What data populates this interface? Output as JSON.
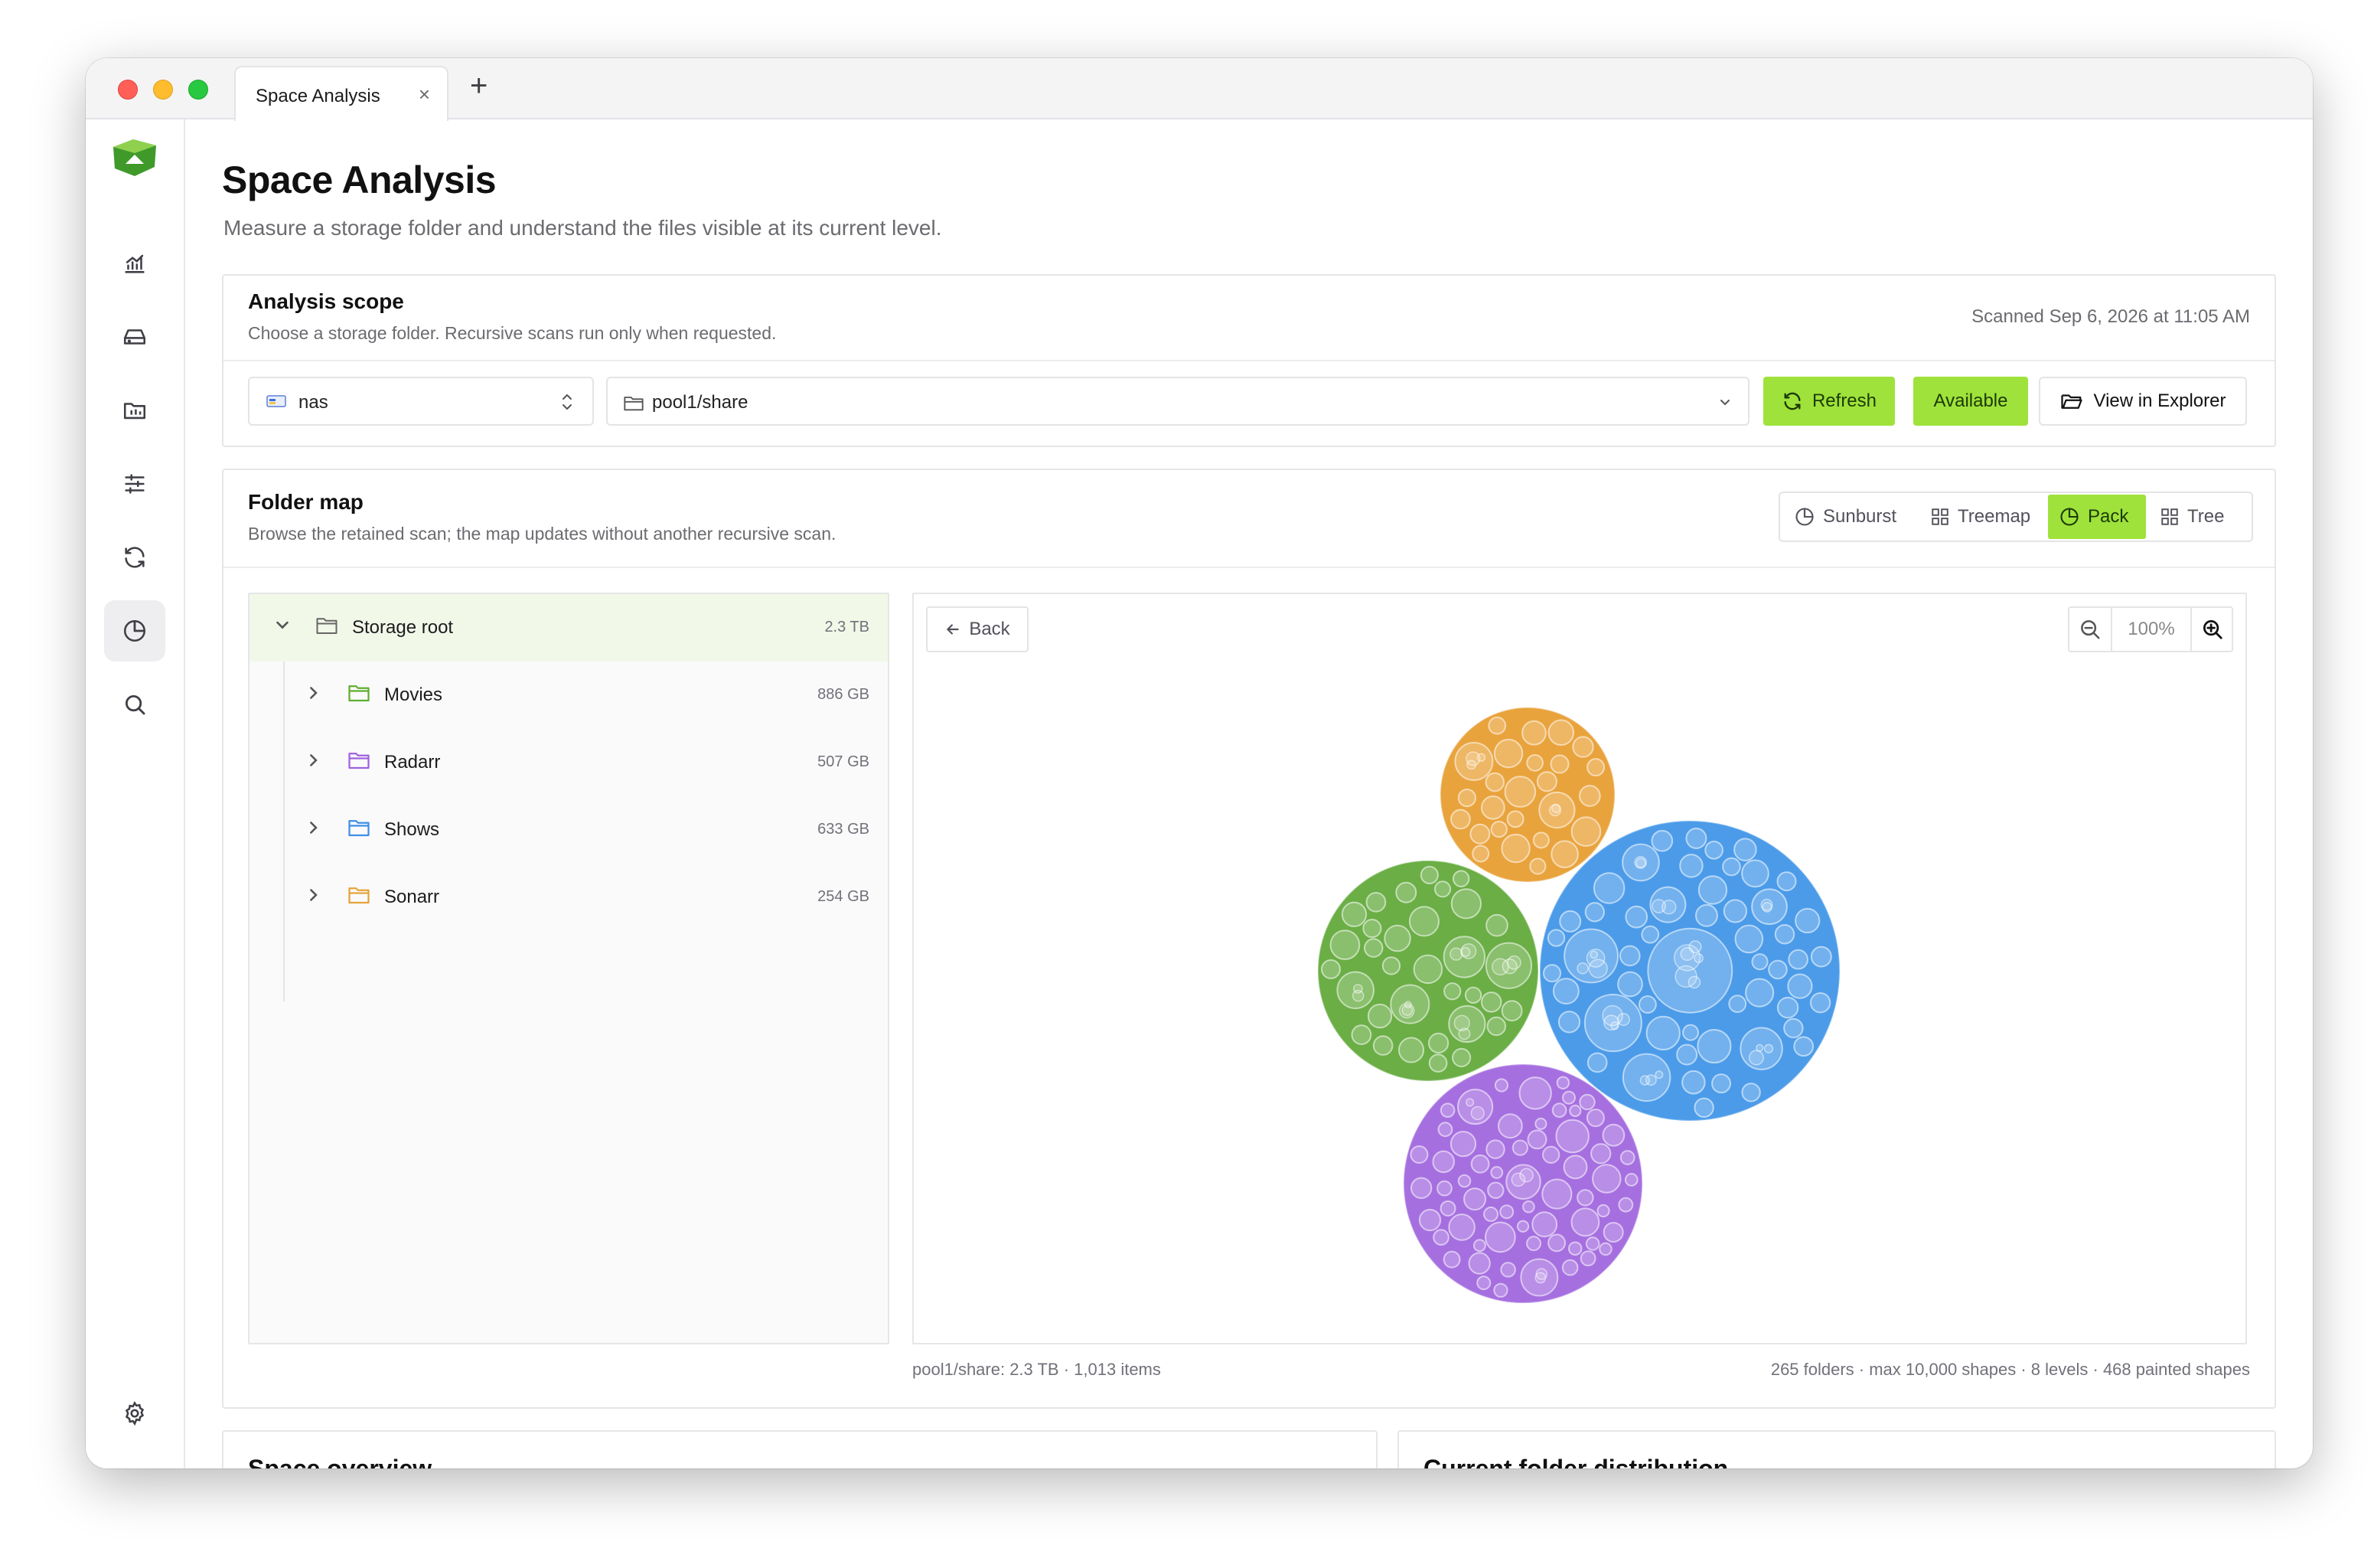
{
  "window": {
    "tab_title": "Space Analysis",
    "tab_close": "×",
    "new_tab": "+"
  },
  "sidebar": {
    "items": [
      {
        "name": "dashboard",
        "icon": "chart-bars-icon"
      },
      {
        "name": "storage",
        "icon": "drive-icon"
      },
      {
        "name": "files",
        "icon": "folder-grid-icon"
      },
      {
        "name": "settings-sliders",
        "icon": "sliders-icon"
      },
      {
        "name": "sync",
        "icon": "refresh-icon"
      },
      {
        "name": "space-analysis",
        "icon": "pie-chart-icon",
        "active": true
      },
      {
        "name": "search",
        "icon": "search-icon"
      }
    ],
    "bottom": {
      "name": "settings",
      "icon": "gear-icon"
    }
  },
  "page": {
    "title": "Space Analysis",
    "subtitle": "Measure a storage folder and understand the files visible at its current level."
  },
  "scope": {
    "title": "Analysis scope",
    "description": "Choose a storage folder. Recursive scans run only when requested.",
    "scanned": "Scanned Sep 6, 2026 at 11:05 AM",
    "storage_value": "nas",
    "path_value": "pool1/share",
    "refresh_label": "Refresh",
    "available_label": "Available",
    "explorer_label": "View in Explorer"
  },
  "folder_map": {
    "title": "Folder map",
    "description": "Browse the retained scan; the map updates without another recursive scan.",
    "views": [
      "Sunburst",
      "Treemap",
      "Pack",
      "Tree"
    ],
    "active_view": "Pack",
    "tree": {
      "root": {
        "label": "Storage root",
        "size": "2.3 TB"
      },
      "children": [
        {
          "label": "Movies",
          "size": "886 GB",
          "color": "#5fae2e"
        },
        {
          "label": "Radarr",
          "size": "507 GB",
          "color": "#a061e0"
        },
        {
          "label": "Shows",
          "size": "633 GB",
          "color": "#3d8fe6"
        },
        {
          "label": "Sonarr",
          "size": "254 GB",
          "color": "#e5a33a"
        }
      ]
    },
    "back_label": "Back",
    "zoom": "100%",
    "footer_left": "pool1/share: 2.3 TB · 1,013 items",
    "footer_right": "265 folders · max 10,000 shapes · 8 levels · 468 painted shapes",
    "pack_colors": {
      "orange": "#e9a33c",
      "green": "#6aae45",
      "blue": "#4b9be9",
      "purple": "#a66fe0"
    }
  },
  "bottom_cards": {
    "left_title": "Space overview",
    "right_title": "Current folder distribution"
  }
}
